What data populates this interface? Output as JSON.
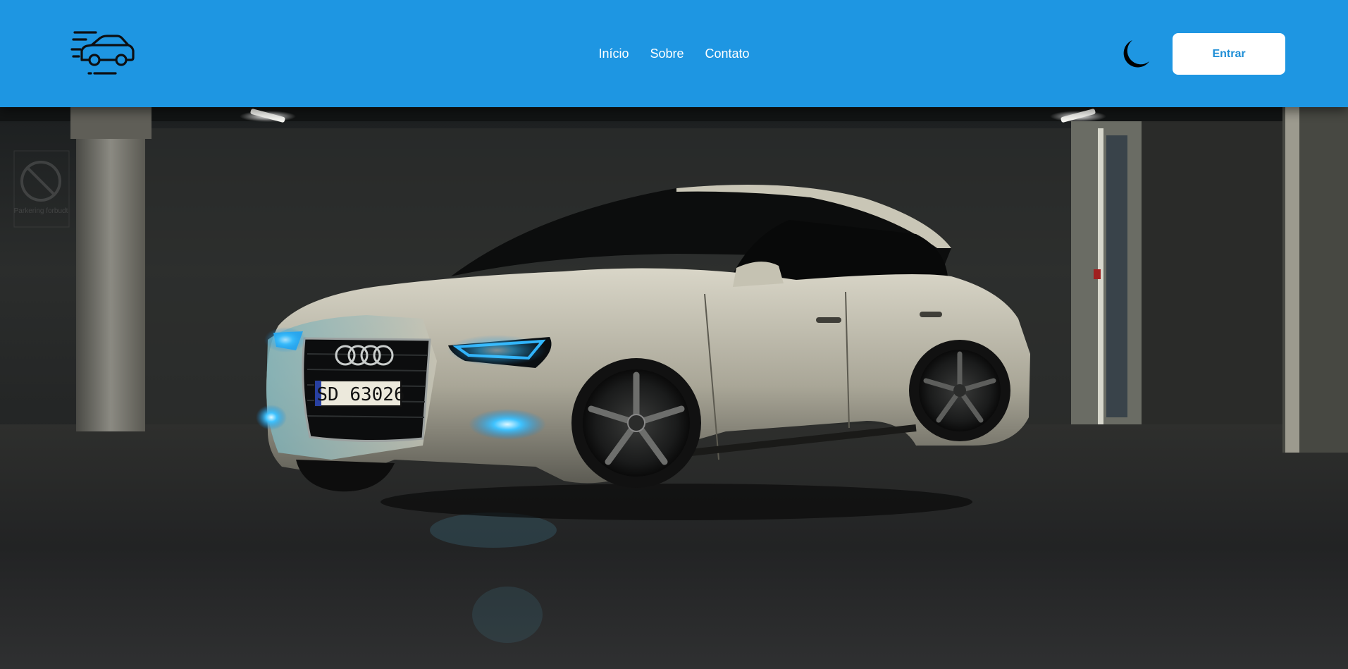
{
  "header": {
    "background": "#1e96e2",
    "logo_icon": "speeding-car-icon",
    "nav": [
      {
        "label": "Início"
      },
      {
        "label": "Sobre"
      },
      {
        "label": "Contato"
      }
    ],
    "theme_toggle_icon": "moon-icon",
    "login_label": "Entrar",
    "login_text_color": "#1e8ed6"
  },
  "hero": {
    "image": "white-audi-car-in-dark-parking-garage",
    "plate_text": "SD 63026",
    "sign_text": "Parkering forbudt"
  }
}
